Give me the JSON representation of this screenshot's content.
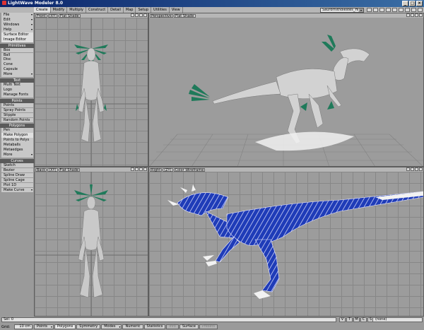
{
  "window": {
    "title": "LightWave Modeler 8.0",
    "controls": [
      "_",
      "□",
      "×"
    ]
  },
  "tabs": [
    {
      "label": "Create",
      "active": true
    },
    {
      "label": "Modify"
    },
    {
      "label": "Multiply"
    },
    {
      "label": "Construct"
    },
    {
      "label": "Detail"
    },
    {
      "label": "Map"
    },
    {
      "label": "Setup"
    },
    {
      "label": "Utilities"
    },
    {
      "label": "View"
    }
  ],
  "object_selector": {
    "value": "Saurornitholestes_Hi_R"
  },
  "toolbox": {
    "top": [
      {
        "label": "File",
        "dropdown": true
      },
      {
        "label": "Edit",
        "dropdown": true
      },
      {
        "label": "Windows",
        "dropdown": true
      },
      {
        "label": "Help",
        "dropdown": true
      },
      {
        "label": "Surface Editor",
        "selected": true
      },
      {
        "label": "Image Editor",
        "selected": true
      }
    ],
    "groups": [
      {
        "header": "Primitives",
        "items": [
          {
            "label": "Box"
          },
          {
            "label": "Ball"
          },
          {
            "label": "Disc"
          },
          {
            "label": "Cone"
          },
          {
            "label": "Capsule"
          },
          {
            "label": "More",
            "dropdown": true
          }
        ]
      },
      {
        "header": "Text",
        "items": [
          {
            "label": "Multi Text"
          },
          {
            "label": "Logo"
          },
          {
            "label": "Manage Fonts"
          }
        ]
      },
      {
        "header": "Points",
        "items": [
          {
            "label": "Points"
          },
          {
            "label": "Spray Points"
          },
          {
            "label": "Stipple"
          },
          {
            "label": "Random Points"
          }
        ]
      },
      {
        "header": "Polygons",
        "items": [
          {
            "label": "Pen"
          },
          {
            "label": "Make Polygon",
            "selected": true
          },
          {
            "label": "Points to Polys"
          },
          {
            "label": "Metaballs"
          },
          {
            "label": "Metaedges"
          },
          {
            "label": "More",
            "dropdown": true
          }
        ]
      },
      {
        "header": "Curves",
        "items": [
          {
            "label": "Sketch"
          },
          {
            "label": "Bezier"
          },
          {
            "label": "Spline Draw"
          },
          {
            "label": "Spline Cage"
          },
          {
            "label": "Plot 1D"
          },
          {
            "label": "Make Curve",
            "dropdown": true
          }
        ]
      }
    ]
  },
  "viewports": [
    {
      "view": "Front",
      "axis": "(XY)",
      "shading": "Flat Shade"
    },
    {
      "view": "Perspective",
      "shading": "Flat Shade"
    },
    {
      "view": "Back",
      "axis": "(XY)",
      "shading": "Flat Shade"
    },
    {
      "view": "Right",
      "axis": "(ZY)",
      "shading": "Color Wireframe"
    }
  ],
  "status": {
    "sel_label": "Sel:",
    "sel_value": "0",
    "layer_buttons": [
      "V",
      "T",
      "M",
      "C",
      "S"
    ],
    "vmap_value": "(none)"
  },
  "bottom": {
    "grid_label": "Grid:",
    "grid_value": "10 cm",
    "modes": [
      {
        "label": "Points",
        "dropdown": true
      },
      {
        "label": "Polygons",
        "active": true
      },
      {
        "label": "Symmetry"
      },
      {
        "label": "Modes",
        "dropdown": true
      },
      {
        "label": "Numeric"
      },
      {
        "label": "Statistics"
      },
      {
        "label": "Info",
        "dim": true
      },
      {
        "label": "Surface"
      },
      {
        "label": "Presets",
        "dim": true
      }
    ]
  },
  "colors": {
    "feather": "#1f7a5a",
    "mesh": "#c9c9c9",
    "wireframe": "#1f3cb8",
    "viewport_bg": "#9c9c9c",
    "title_bar": "#0a246a"
  }
}
